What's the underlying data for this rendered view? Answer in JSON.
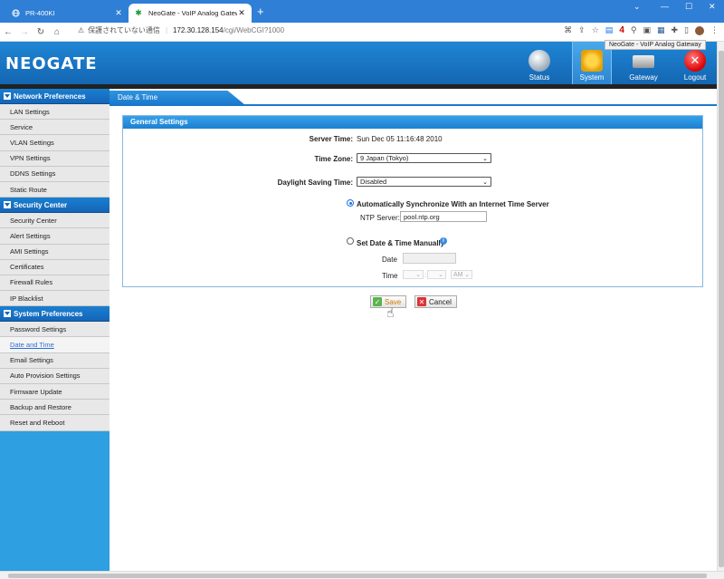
{
  "browser": {
    "tabs": [
      {
        "title": "PR-400KI",
        "active": false
      },
      {
        "title": "NeoGate - VoIP Analog Gateway",
        "active": true
      }
    ],
    "address": {
      "security_label": "保護されていない通信",
      "host": "172.30.128.154",
      "path": "/cgi/WebCGI?1000"
    },
    "tooltip": "NeoGate - VoIP Analog Gateway",
    "badge_number": "4"
  },
  "header": {
    "logo": "NEOGATE",
    "nav": [
      {
        "label": "Status"
      },
      {
        "label": "System"
      },
      {
        "label": "Gateway"
      },
      {
        "label": "Logout"
      }
    ]
  },
  "sidebar": {
    "sections": [
      {
        "title": "Network Preferences",
        "items": [
          "LAN Settings",
          "Service",
          "VLAN Settings",
          "VPN Settings",
          "DDNS Settings",
          "Static Route"
        ]
      },
      {
        "title": "Security Center",
        "items": [
          "Security Center",
          "Alert Settings",
          "AMI Settings",
          "Certificates",
          "Firewall Rules",
          "IP Blacklist"
        ]
      },
      {
        "title": "System Preferences",
        "items": [
          "Password Settings",
          "Date and Time",
          "Email Settings",
          "Auto Provision Settings",
          "Firmware Update",
          "Backup and Restore",
          "Reset and Reboot"
        ]
      }
    ],
    "active_item": "Date and Time"
  },
  "content": {
    "tab_title": "Date & Time",
    "panel_title": "General Settings",
    "server_time_label": "Server Time:",
    "server_time_value": "Sun Dec 05 11:16:48 2010",
    "time_zone_label": "Time Zone:",
    "time_zone_value": "9 Japan (Tokyo)",
    "dst_label": "Daylight Saving Time:",
    "dst_value": "Disabled",
    "auto_sync_label": "Automatically Synchronize With an Internet Time Server",
    "ntp_label": "NTP Server:",
    "ntp_value": "pool.ntp.org",
    "manual_label": "Set Date & Time Manually",
    "date_label": "Date",
    "time_label": "Time",
    "time_colon": ":",
    "ampm_value": "AM",
    "save_label": "Save",
    "cancel_label": "Cancel"
  },
  "colors": {
    "header_blue": "#1466b2",
    "sidebar_blue": "#2e9fe0",
    "link_blue": "#2e6fd6"
  }
}
